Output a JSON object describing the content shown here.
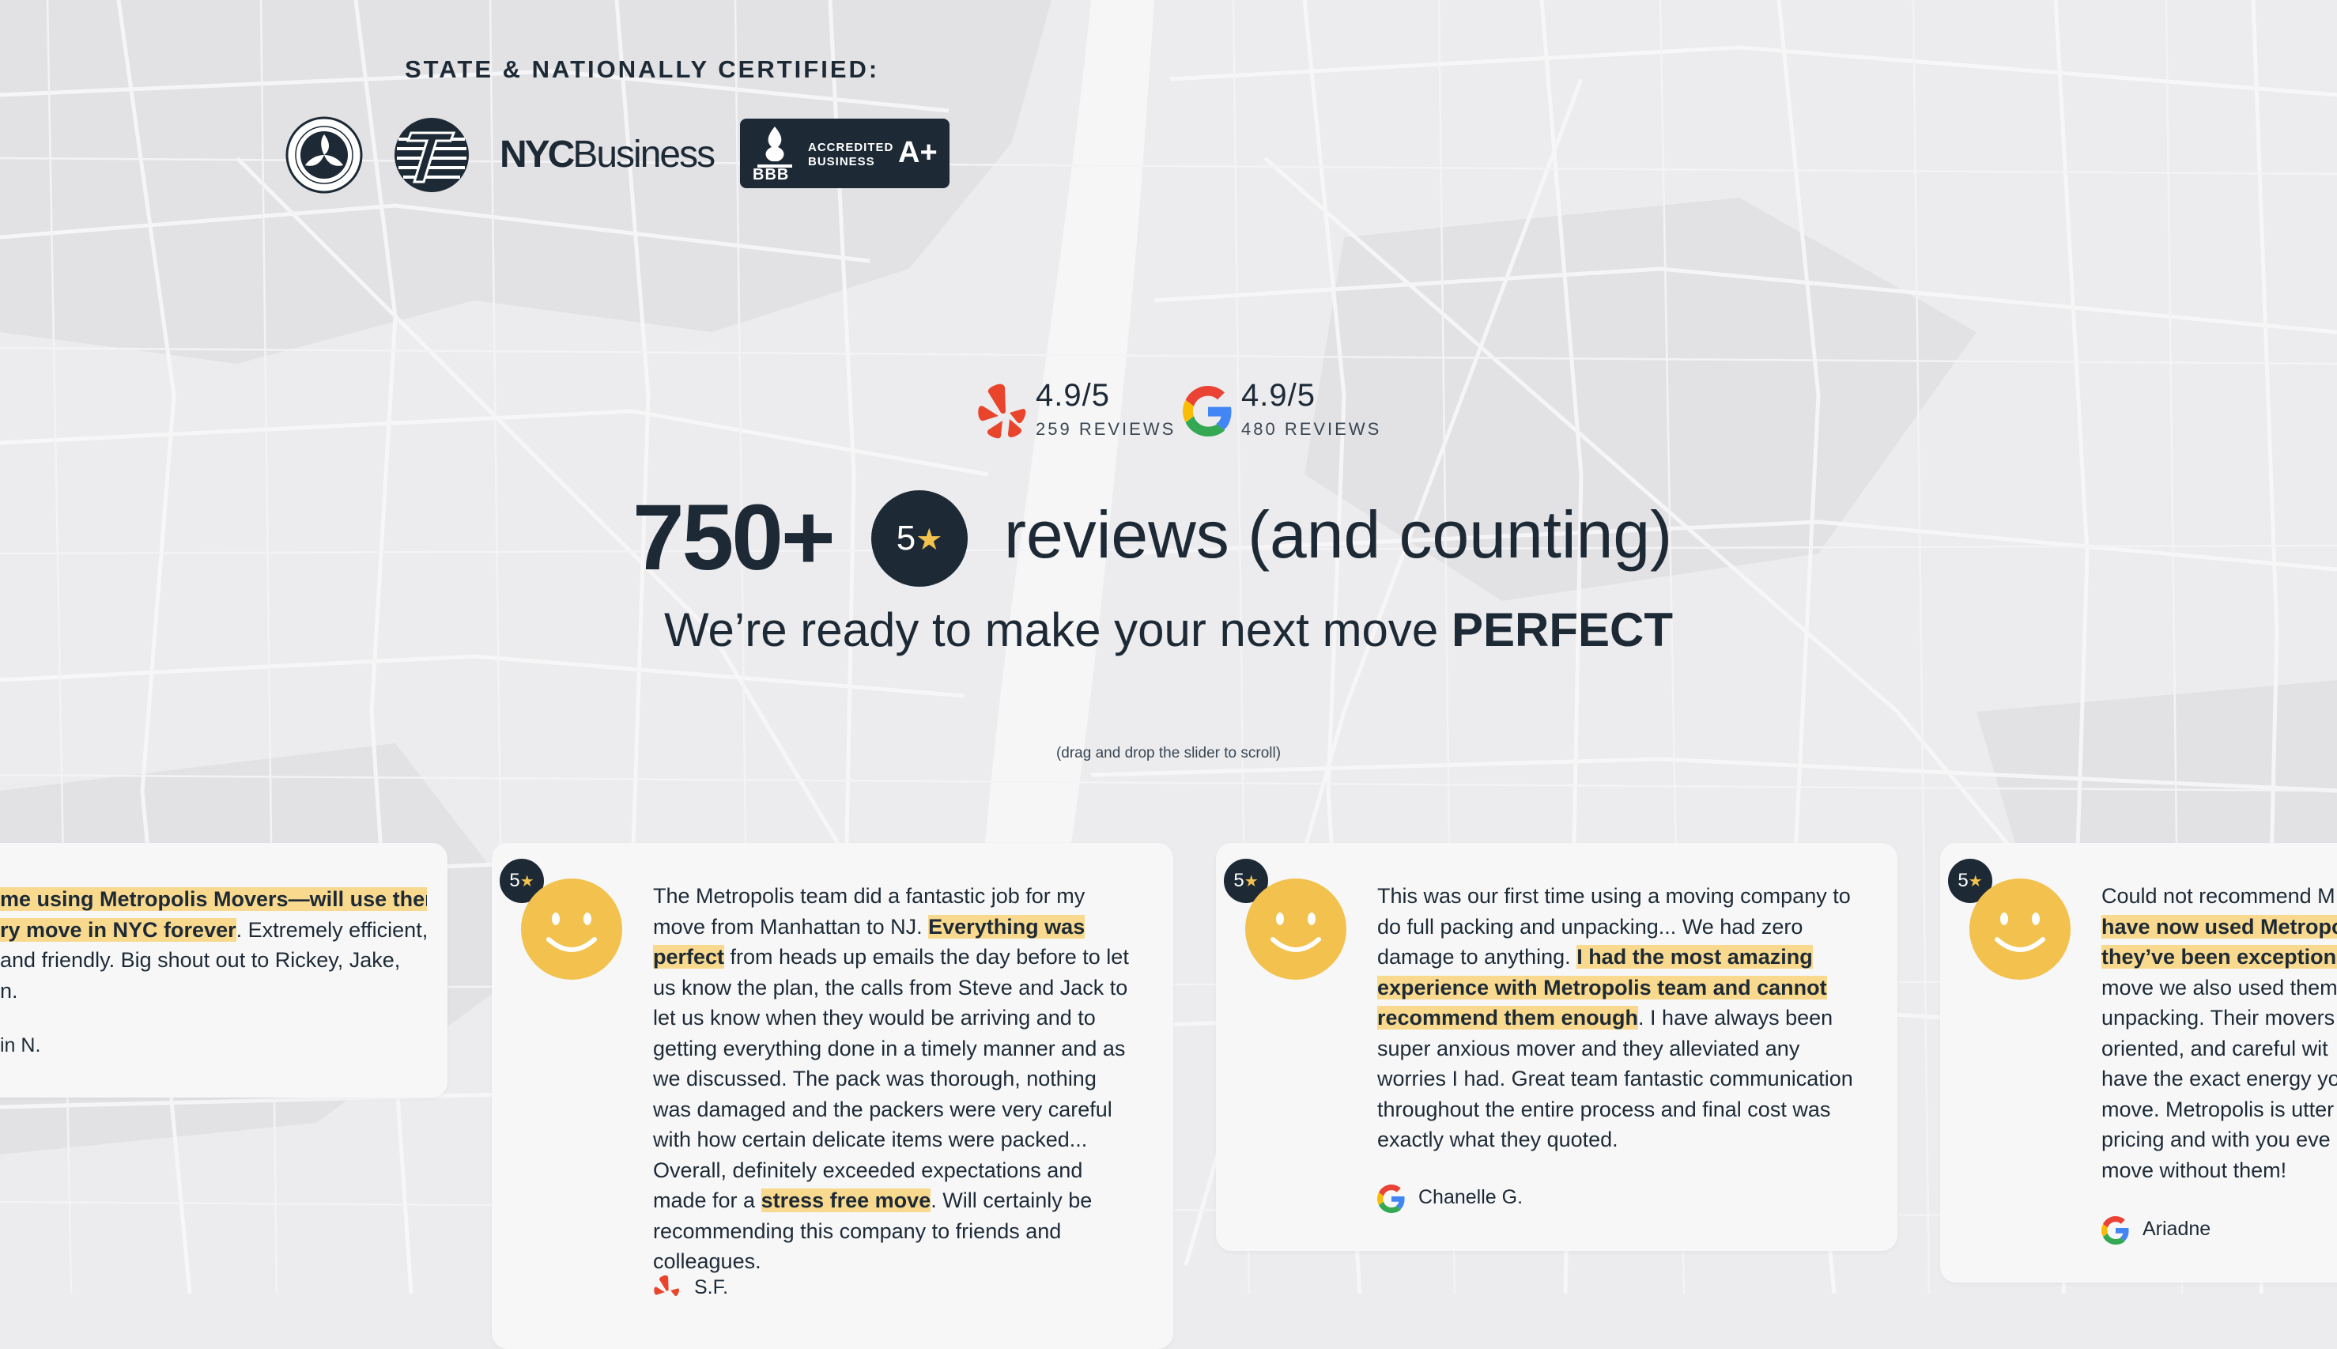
{
  "certified": {
    "title": "STATE & NATIONALLY CERTIFIED:",
    "logos": [
      "dot-seal-icon",
      "fmcsa-seal-icon",
      "nyc-business-logo",
      "bbb-accredited-logo"
    ],
    "nyc_business_bold": "NYC",
    "nyc_business_rest": "Business",
    "bbb_label": "BBB",
    "bbb_line1": "ACCREDITED",
    "bbb_line2": "BUSINESS",
    "bbb_grade": "A+"
  },
  "ratings": [
    {
      "source_icon": "yelp-icon",
      "score": "4.9/5",
      "count": "259 REVIEWS"
    },
    {
      "source_icon": "google-icon",
      "score": "4.9/5",
      "count": "480 REVIEWS"
    }
  ],
  "headline": {
    "count": "750+",
    "badge_number": "5",
    "badge_star": "★",
    "text": "reviews (and counting)"
  },
  "subheadline": {
    "text": "We’re ready to make your next move ",
    "emphasis": "PERFECT"
  },
  "hint": "(drag and drop the slider to scroll)",
  "reviews": [
    {
      "rating": "5",
      "star": "★",
      "lines": [
        {
          "plain": "",
          "highlight": "me using Metropolis Movers—will use them"
        },
        {
          "highlight": "ry move in NYC forever",
          "plain": ". Extremely efficient,"
        },
        {
          "plain": " and friendly. Big shout out to Rickey, Jake,"
        },
        {
          "plain": "n."
        }
      ],
      "author": "in N.",
      "source_icon": "yelp-icon"
    },
    {
      "rating": "5",
      "star": "★",
      "p1": "The Metropolis team did a fantastic job for my move from Manhattan to NJ. ",
      "h1": "Everything was perfect",
      "p2": " from heads up emails the day before to let us know the plan, the calls from Steve and Jack to let us know when they would be arriving and to getting everything done in a timely manner and as we discussed. The pack was thorough, nothing was damaged and the packers were very careful with how certain delicate items were packed... Overall, definitely exceeded expectations and made for a ",
      "h2": "stress free move",
      "p3": ". Will certainly be recommending this company to friends and colleagues.",
      "author": "S.F.",
      "source_icon": "yelp-icon"
    },
    {
      "rating": "5",
      "star": "★",
      "p1": "This was our first time using a moving company to do full packing and unpacking... We had zero damage to anything. ",
      "h1": "I had the most amazing experience with Metropolis team and cannot recommend them enough",
      "p2": ". I have always been super anxious mover and they alleviated any worries I had. Great team fantastic communication throughout the entire process and final cost was exactly what they quoted.",
      "author": "Chanelle G.",
      "source_icon": "google-icon"
    },
    {
      "rating": "5",
      "star": "★",
      "lines": [
        {
          "plain": "Could not recommend M"
        },
        {
          "highlight": "have now used Metropo"
        },
        {
          "highlight": "they’ve been exceptiona"
        },
        {
          "plain": "move we also used them"
        },
        {
          "plain": "unpacking. Their movers"
        },
        {
          "plain": "oriented, and careful wit"
        },
        {
          "plain": "have the exact energy yo"
        },
        {
          "plain": "move. Metropolis is utter"
        },
        {
          "plain": "pricing and with you eve"
        },
        {
          "plain": "move without them!"
        }
      ],
      "author": "Ariadne",
      "source_icon": "google-icon"
    }
  ],
  "colors": {
    "navy": "#1d2a36",
    "highlight": "#f8d98e",
    "smiley": "#f2c14e",
    "yelp_red": "#e8452c",
    "background": "#ececee"
  }
}
